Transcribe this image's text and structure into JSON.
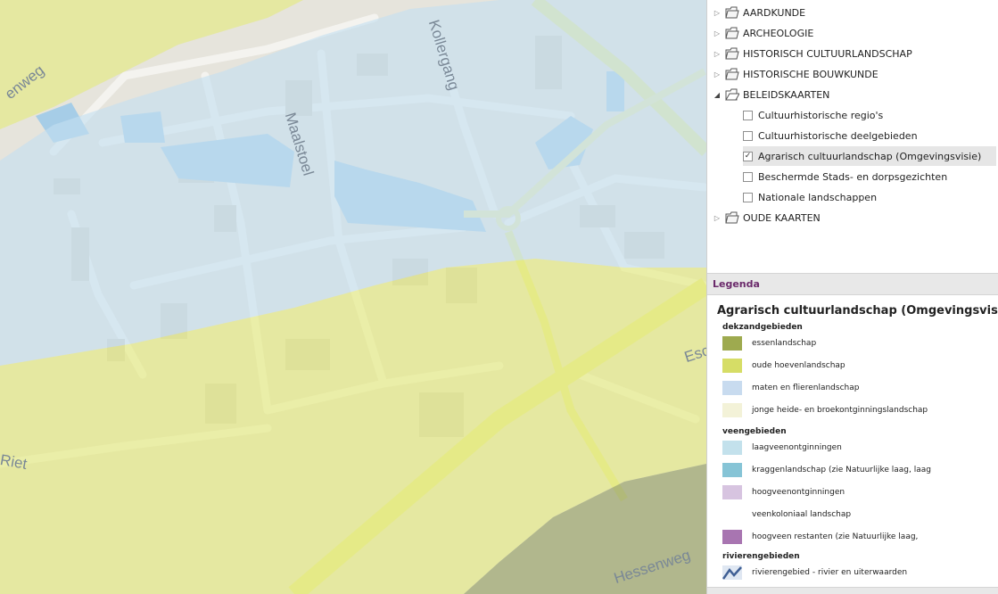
{
  "map": {
    "streets": [
      "Kollergang",
      "Maalstoel",
      "Hessenweg",
      "enweg",
      "Riet",
      "Esc"
    ]
  },
  "layer_tree": {
    "groups": [
      {
        "label": "AARDKUNDE",
        "expanded": false
      },
      {
        "label": "ARCHEOLOGIE",
        "expanded": false
      },
      {
        "label": "HISTORISCH CULTUURLANDSCHAP",
        "expanded": false
      },
      {
        "label": "HISTORISCHE BOUWKUNDE",
        "expanded": false
      },
      {
        "label": "BELEIDSKAARTEN",
        "expanded": true
      },
      {
        "label": "OUDE KAARTEN",
        "expanded": false
      }
    ],
    "beleidskaarten_layers": [
      {
        "label": "Cultuurhistorische regio's",
        "checked": false
      },
      {
        "label": "Cultuurhistorische deelgebieden",
        "checked": false
      },
      {
        "label": "Agrarisch cultuurlandschap (Omgevingsvisie)",
        "checked": true
      },
      {
        "label": "Beschermde Stads- en dorpsgezichten",
        "checked": false
      },
      {
        "label": "Nationale landschappen",
        "checked": false
      }
    ]
  },
  "legend": {
    "header": "Legenda",
    "title": "Agrarisch cultuurlandschap (Omgevingsvisie)",
    "sections": [
      {
        "name": "dekzandgebieden",
        "items": [
          {
            "label": "essenlandschap",
            "color": "#9eaa4f"
          },
          {
            "label": "oude hoevenlandschap",
            "color": "#d6dd66"
          },
          {
            "label": "maten en flierenlandschap",
            "color": "#c8dbef"
          },
          {
            "label": "jonge heide- en broekontginningslandschap",
            "color": "#f3f2d8"
          }
        ]
      },
      {
        "name": "veengebieden",
        "items": [
          {
            "label": "laagveenontginningen",
            "color": "#c3e1ec"
          },
          {
            "label": "kraggenlandschap (zie Natuurlijke laag, laag",
            "color": "#86c4d6"
          },
          {
            "label": "hoogveenontginningen",
            "color": "#d7c4e0"
          },
          {
            "label": "veenkoloniaal landschap",
            "color": "#ffffff"
          },
          {
            "label": "hoogveen restanten (zie Natuurlijke laag,",
            "color": "#a875b1"
          }
        ]
      },
      {
        "name": "rivierengebieden",
        "items": [
          {
            "label": "rivierengebied - rivier en uiterwaarden",
            "color": "#5b7fb0"
          }
        ]
      }
    ]
  }
}
